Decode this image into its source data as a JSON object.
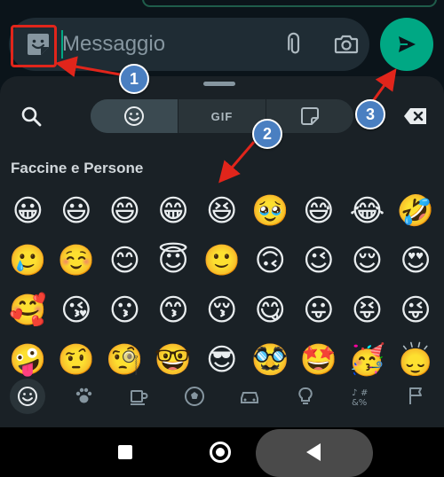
{
  "composer": {
    "placeholder": "Messaggio"
  },
  "picker": {
    "tabs": [
      {
        "name": "emoji",
        "label": ""
      },
      {
        "name": "gif",
        "label": "GIF"
      },
      {
        "name": "sticker",
        "label": ""
      }
    ],
    "section_title": "Faccine e Persone",
    "emoji_rows": [
      [
        "😀",
        "😃",
        "😄",
        "😁",
        "😆",
        "🥹",
        "😅",
        "😂",
        "🤣"
      ],
      [
        "🥲",
        "☺️",
        "😊",
        "😇",
        "🙂",
        "🙃",
        "😉",
        "😌",
        "😍"
      ],
      [
        "🥰",
        "😘",
        "😗",
        "😙",
        "😚",
        "😋",
        "😛",
        "😝",
        "😜"
      ],
      [
        "🤪",
        "🤨",
        "🧐",
        "🤓",
        "😎",
        "🥸",
        "🤩",
        "🥳",
        "🙂‍↕️"
      ]
    ],
    "categories": [
      {
        "name": "smileys",
        "glyph": "☺"
      },
      {
        "name": "animals",
        "glyph": "🐾"
      },
      {
        "name": "food",
        "glyph": "☕"
      },
      {
        "name": "activity",
        "glyph": "⚽"
      },
      {
        "name": "travel",
        "glyph": "🚗"
      },
      {
        "name": "objects",
        "glyph": "💡"
      },
      {
        "name": "symbols",
        "glyph": "&%"
      },
      {
        "name": "flags",
        "glyph": "⚑"
      }
    ]
  },
  "annotations": {
    "markers": [
      "1",
      "2",
      "3"
    ]
  },
  "colors": {
    "accent": "#00a884",
    "highlight": "#e1251b",
    "marker": "#4a7fc1"
  }
}
